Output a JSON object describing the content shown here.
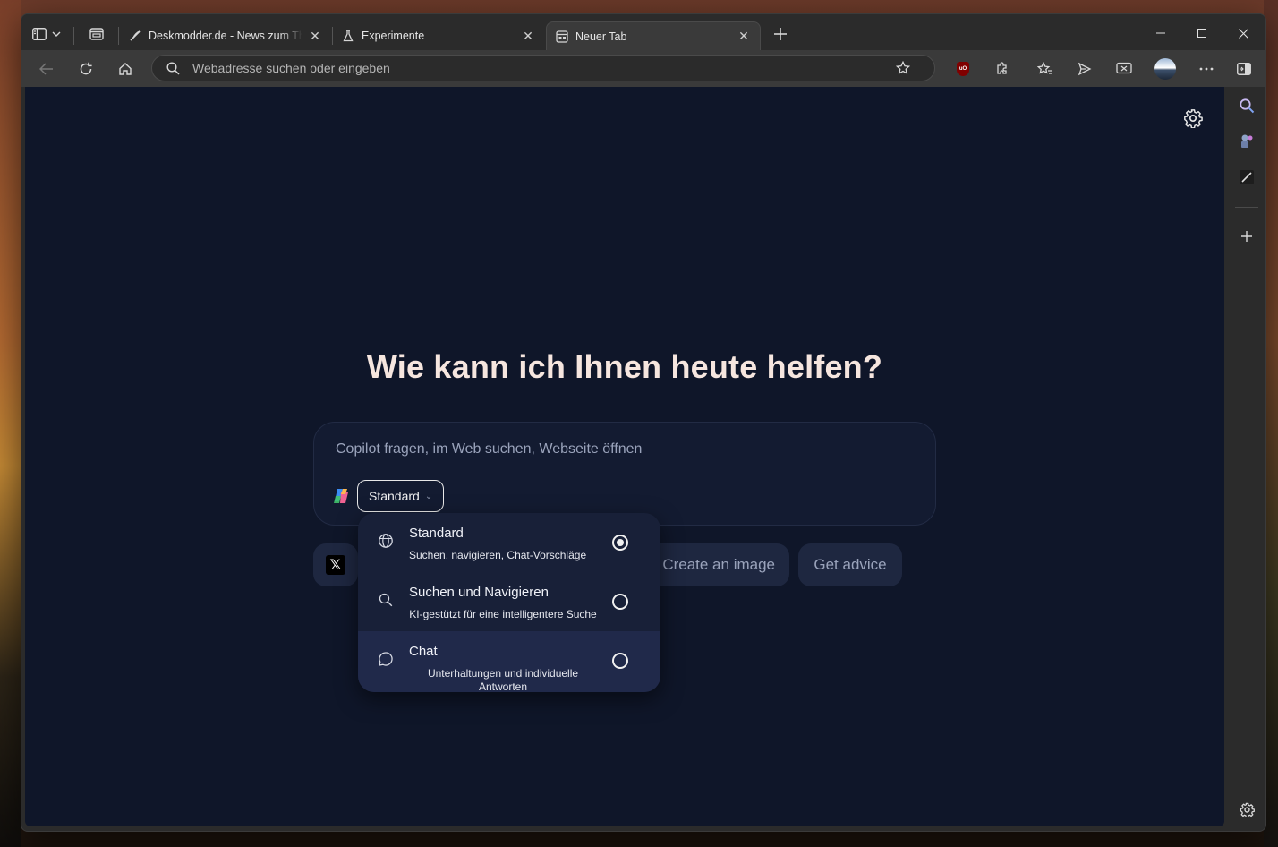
{
  "tabs": [
    {
      "title": "Deskmodder.de - News zum Thema Windows",
      "active": false
    },
    {
      "title": "Experimente",
      "active": false
    },
    {
      "title": "Neuer Tab",
      "active": true
    }
  ],
  "addressbar": {
    "placeholder": "Webadresse suchen oder eingeben"
  },
  "extensions": {
    "ublock_badge": "uO"
  },
  "newtab": {
    "headline": "Wie kann ich Ihnen heute helfen?",
    "composer_placeholder": "Copilot fragen, im Web suchen, Webseite öffnen",
    "mode_label": "Standard",
    "chips": [
      "Create an image",
      "Get advice"
    ],
    "x_chip_glyph": "𝕏"
  },
  "mode_dropdown": {
    "options": [
      {
        "title": "Standard",
        "desc": "Suchen, navigieren, Chat-Vorschläge",
        "selected": true
      },
      {
        "title": "Suchen und Navigieren",
        "desc": "KI-gestützt für eine intelligentere Suche",
        "selected": false
      },
      {
        "title": "Chat",
        "desc": "Unterhaltungen und individuelle Antworten",
        "selected": false
      }
    ]
  },
  "colors": {
    "page_bg": "#0f1629",
    "headline": "#f6e6df",
    "chip_bg": "#1e2740",
    "dropdown_bg": "#182038"
  }
}
